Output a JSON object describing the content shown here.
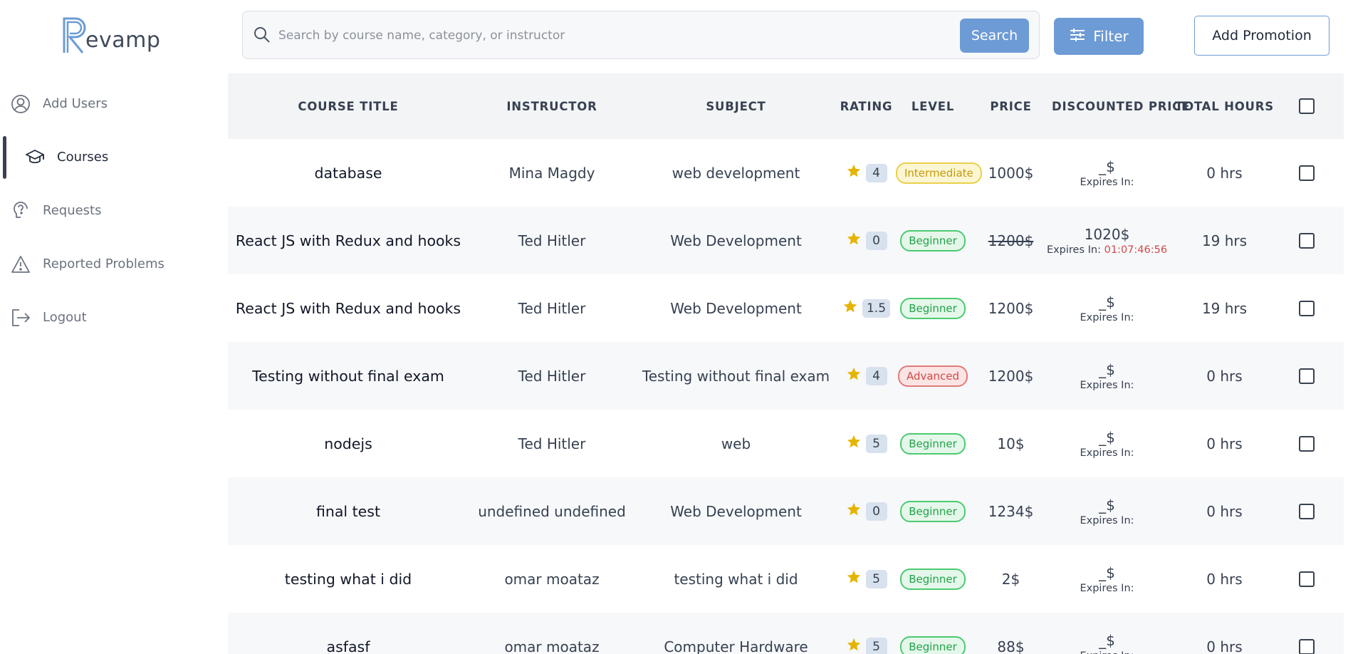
{
  "brand": {
    "name": "evamp",
    "logo_icon": "revamp-R-logo"
  },
  "sidebar": {
    "items": [
      {
        "label": "Add Users",
        "icon": "user-circle-icon",
        "active": false
      },
      {
        "label": "Courses",
        "icon": "graduation-cap-icon",
        "active": true
      },
      {
        "label": "Requests",
        "icon": "lightbulb-question-icon",
        "active": false
      },
      {
        "label": "Reported Problems",
        "icon": "warning-triangle-icon",
        "active": false
      },
      {
        "label": "Logout",
        "icon": "logout-icon",
        "active": false
      }
    ]
  },
  "toolbar": {
    "search_placeholder": "Search by course name, category, or instructor",
    "search_value": "",
    "search_label": "Search",
    "filter_label": "Filter",
    "promotion_label": "Add Promotion"
  },
  "table": {
    "headers": {
      "title": "COURSE TITLE",
      "instructor": "INSTRUCTOR",
      "subject": "SUBJECT",
      "rating": "RATING",
      "level": "LEVEL",
      "price": "PRICE",
      "discounted": "DISCOUNTED PRICE",
      "hours": "TOTAL HOURS"
    },
    "rows": [
      {
        "title": "database",
        "instructor": "Mina Magdy",
        "subject": "web development",
        "rating": "4",
        "level": "Intermediate",
        "price": "1000$",
        "price_struck": false,
        "discounted": "_$",
        "expires_label": "Expires In:",
        "expires_timer": "",
        "hours": "0 hrs"
      },
      {
        "title": "React JS with Redux and hooks",
        "instructor": "Ted Hitler",
        "subject": "Web Development",
        "rating": "0",
        "level": "Beginner",
        "price": "1200$",
        "price_struck": true,
        "discounted": "1020$",
        "expires_label": "Expires In:",
        "expires_timer": "01:07:46:56",
        "hours": "19 hrs"
      },
      {
        "title": "React JS with Redux and hooks",
        "instructor": "Ted Hitler",
        "subject": "Web Development",
        "rating": "1.5",
        "level": "Beginner",
        "price": "1200$",
        "price_struck": false,
        "discounted": "_$",
        "expires_label": "Expires In:",
        "expires_timer": "",
        "hours": "19 hrs"
      },
      {
        "title": "Testing without final exam",
        "instructor": "Ted Hitler",
        "subject": "Testing without final exam",
        "rating": "4",
        "level": "Advanced",
        "price": "1200$",
        "price_struck": false,
        "discounted": "_$",
        "expires_label": "Expires In:",
        "expires_timer": "",
        "hours": "0 hrs"
      },
      {
        "title": "nodejs",
        "instructor": "Ted Hitler",
        "subject": "web",
        "rating": "5",
        "level": "Beginner",
        "price": "10$",
        "price_struck": false,
        "discounted": "_$",
        "expires_label": "Expires In:",
        "expires_timer": "",
        "hours": "0 hrs"
      },
      {
        "title": "final test",
        "instructor": "undefined undefined",
        "subject": "Web Development",
        "rating": "0",
        "level": "Beginner",
        "price": "1234$",
        "price_struck": false,
        "discounted": "_$",
        "expires_label": "Expires In:",
        "expires_timer": "",
        "hours": "0 hrs"
      },
      {
        "title": "testing what i did",
        "instructor": "omar moataz",
        "subject": "testing what i did",
        "rating": "5",
        "level": "Beginner",
        "price": "2$",
        "price_struck": false,
        "discounted": "_$",
        "expires_label": "Expires In:",
        "expires_timer": "",
        "hours": "0 hrs"
      },
      {
        "title": "asfasf",
        "instructor": "omar moataz",
        "subject": "Computer Hardware",
        "rating": "5",
        "level": "Beginner",
        "price": "88$",
        "price_struck": false,
        "discounted": "_$",
        "expires_label": "Expires In:",
        "expires_timer": "",
        "hours": "0 hrs"
      }
    ]
  },
  "colors": {
    "accent": "#6c9bd6",
    "star": "#e5b400",
    "beginner": "#22a34a",
    "intermediate": "#c49a0a",
    "advanced": "#d14949",
    "timer": "#d14949"
  }
}
